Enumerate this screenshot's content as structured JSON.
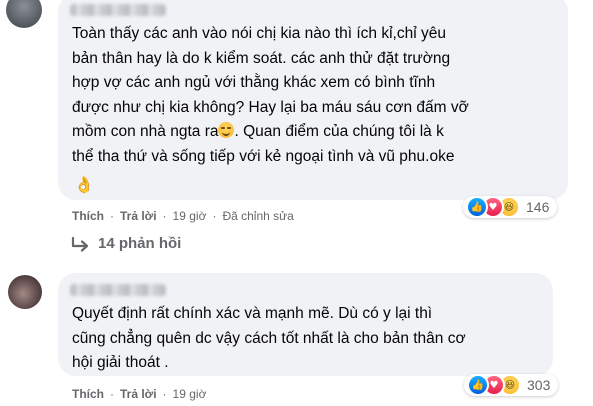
{
  "comment1": {
    "text": "Toàn thấy các anh vào nói chị kia nào thì ích kỉ,chỉ yêu\nbản thân hay là do k kiểm soát. các anh thử đặt trường\nhợp vợ các anh ngủ với thằng khác xem có bình tĩnh\nđược như chị kia không? Hay lại ba máu sáu cơn đấm vỡ\nmồm con nhà ngta ra",
    "text_after_emoji": ". Quan điểm của chúng tôi là k\nthể tha thứ và sống tiếp với kẻ ngoại tình và vũ phu.oke",
    "like_label": "Thích",
    "reply_label": "Trả lời",
    "time": "19 giờ",
    "edited": "Đã chỉnh sửa",
    "reaction_count": "146"
  },
  "replies": {
    "label": "14 phản hồi"
  },
  "comment2": {
    "text": "Quyết định rất chính xác và mạnh mẽ. Dù có y lại thì\ncũng chẳng quên dc vậy cách tốt nhất là cho bản thân cơ\nhội giải thoát .",
    "like_label": "Thích",
    "reply_label": "Trả lời",
    "time": "19 giờ",
    "reaction_count": "303"
  },
  "colors": {
    "bubble": "#f0f2f5",
    "meta": "#65676b",
    "like": "#0062df",
    "love": "#e61e4d",
    "haha": "#f7b125"
  },
  "icons": [
    "like-icon",
    "love-icon",
    "haha-icon",
    "reply-arrow-icon",
    "ok-hand-icon",
    "smirk-emoji-icon"
  ]
}
